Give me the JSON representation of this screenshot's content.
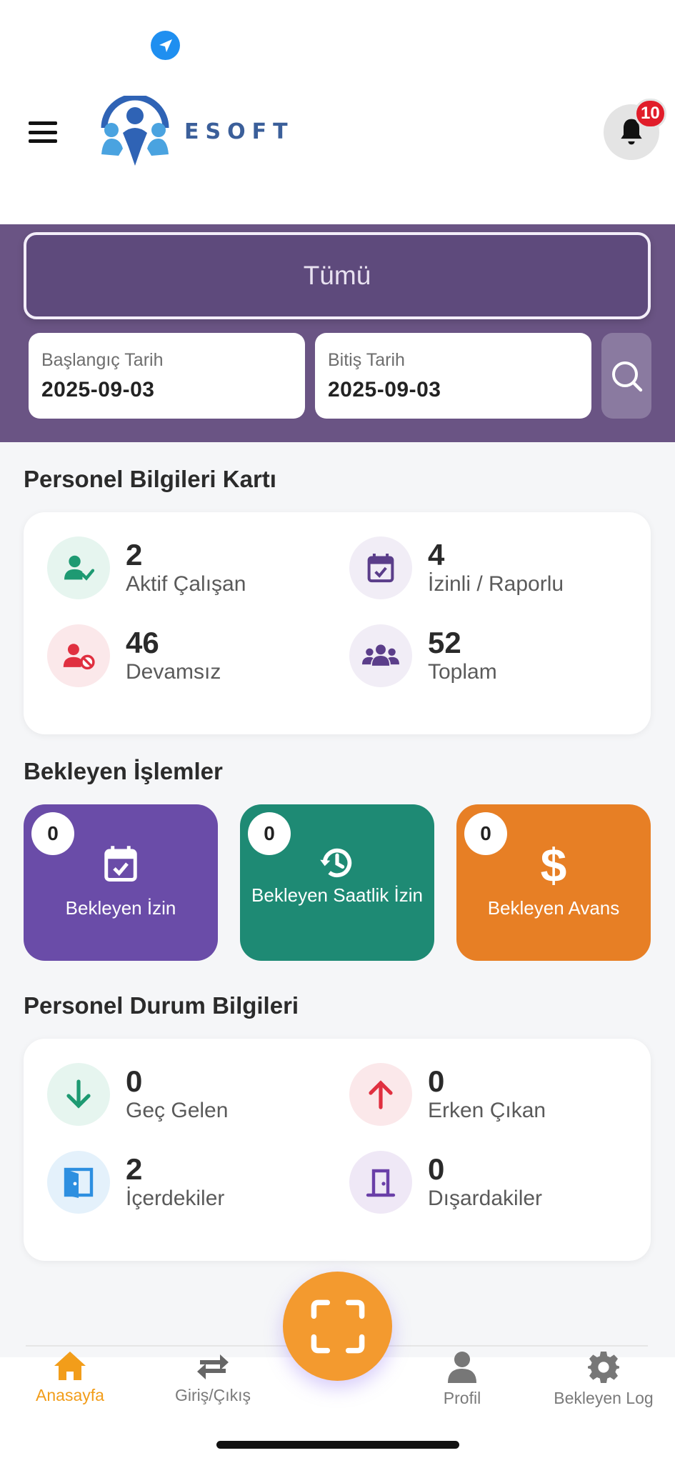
{
  "header": {
    "logo_text": "ESOFT",
    "notification_count": "10"
  },
  "filter": {
    "selected": "Tümü",
    "start_label": "Başlangıç Tarih",
    "start_value": "2025-09-03",
    "end_label": "Bitiş Tarih",
    "end_value": "2025-09-03"
  },
  "personnel_card": {
    "title": "Personel Bilgileri Kartı",
    "stats": [
      {
        "value": "2",
        "label": "Aktif Çalışan",
        "icon": "user-check-icon",
        "color": "#1e9a72"
      },
      {
        "value": "4",
        "label": "İzinli / Raporlu",
        "icon": "calendar-check-icon",
        "color": "#5b3e8a"
      },
      {
        "value": "46",
        "label": "Devamsız",
        "icon": "user-slash-icon",
        "color": "#e03040"
      },
      {
        "value": "52",
        "label": "Toplam",
        "icon": "users-icon",
        "color": "#5b3e8a"
      }
    ]
  },
  "pending": {
    "title": "Bekleyen İşlemler",
    "tiles": [
      {
        "count": "0",
        "label": "Bekleyen İzin",
        "icon": "calendar-check-icon",
        "color": "#6a4ca8"
      },
      {
        "count": "0",
        "label": "Bekleyen Saatlik İzin",
        "icon": "history-icon",
        "color": "#1e8a74"
      },
      {
        "count": "0",
        "label": "Bekleyen Avans",
        "icon": "dollar-icon",
        "color": "#e77f25"
      }
    ]
  },
  "status_card": {
    "title": "Personel Durum Bilgileri",
    "stats": [
      {
        "value": "0",
        "label": "Geç Gelen",
        "icon": "arrow-down-icon",
        "color": "#1e9a72"
      },
      {
        "value": "0",
        "label": "Erken Çıkan",
        "icon": "arrow-up-icon",
        "color": "#e03040"
      },
      {
        "value": "2",
        "label": "İçerdekiler",
        "icon": "door-open-icon",
        "color": "#2d8fe0"
      },
      {
        "value": "0",
        "label": "Dışardakiler",
        "icon": "door-closed-icon",
        "color": "#6a3fa8"
      }
    ]
  },
  "nav": {
    "home": "Anasayfa",
    "entry_exit": "Giriş/Çıkış",
    "profile": "Profil",
    "pending_log": "Bekleyen Log"
  },
  "colors": {
    "accent": "#f29d1a",
    "filter_bg": "#6a5484"
  }
}
